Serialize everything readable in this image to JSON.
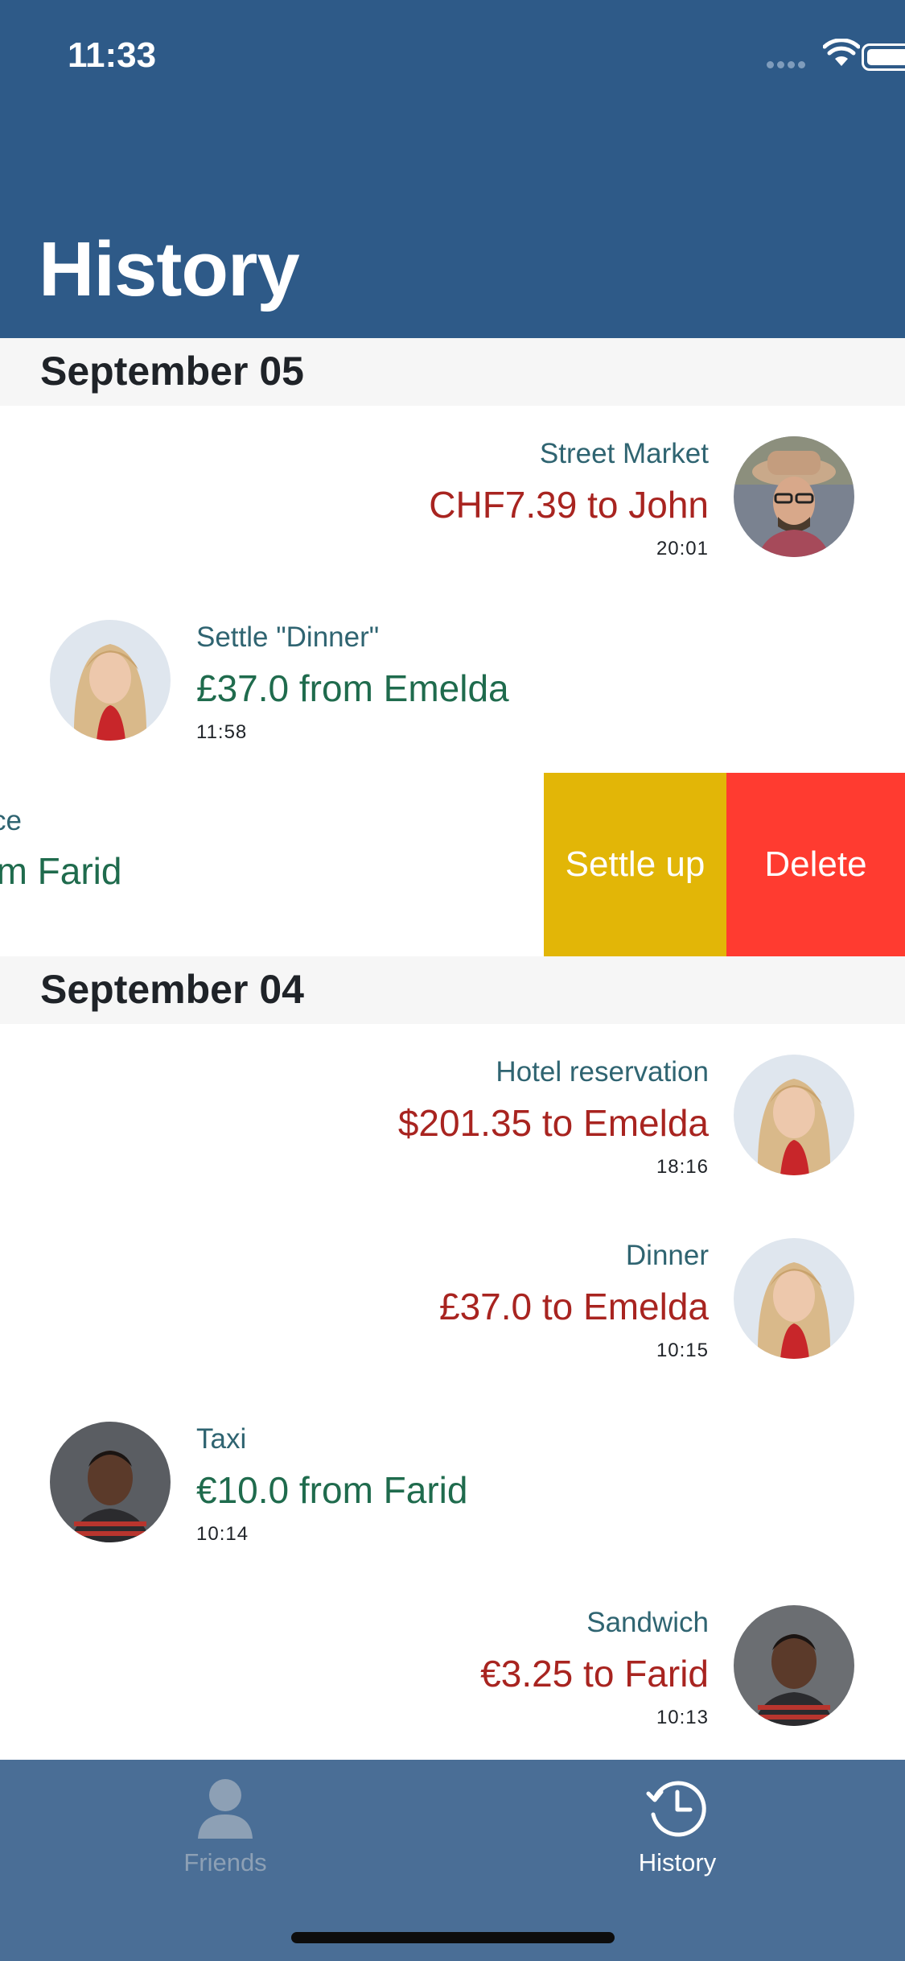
{
  "status_bar": {
    "time": "11:33"
  },
  "header": {
    "title": "History"
  },
  "sections": [
    {
      "label": "September 05"
    },
    {
      "label": "September 04"
    }
  ],
  "transactions": [
    {
      "title": "Street Market",
      "amount": "CHF7.39 to John",
      "time": "20:01",
      "direction": "outgoing",
      "person": "John"
    },
    {
      "title": "Settle \"Dinner\"",
      "amount": "£37.0 from Emelda",
      "time": "11:58",
      "direction": "incoming",
      "person": "Emelda"
    },
    {
      "title": "ce",
      "amount": "om Farid",
      "direction": "incoming",
      "person": "Farid",
      "swiped": true
    },
    {
      "title": "Hotel reservation",
      "amount": "$201.35 to Emelda",
      "time": "18:16",
      "direction": "outgoing",
      "person": "Emelda"
    },
    {
      "title": "Dinner",
      "amount": "£37.0 to Emelda",
      "time": "10:15",
      "direction": "outgoing",
      "person": "Emelda"
    },
    {
      "title": "Taxi",
      "amount": "€10.0 from Farid",
      "time": "10:14",
      "direction": "incoming",
      "person": "Farid"
    },
    {
      "title": "Sandwich",
      "amount": "€3.25 to Farid",
      "time": "10:13",
      "direction": "outgoing",
      "person": "Farid"
    }
  ],
  "swipe_actions": {
    "settle_label": "Settle up",
    "delete_label": "Delete"
  },
  "tabbar": {
    "friends_label": "Friends",
    "history_label": "History",
    "active": "History"
  },
  "colors": {
    "header_bg": "#2e5a88",
    "tabbar_bg": "#4a6e96",
    "outgoing": "#a82420",
    "incoming": "#1f6b4d",
    "settle": "#e2b607",
    "delete": "#ff3b30"
  }
}
